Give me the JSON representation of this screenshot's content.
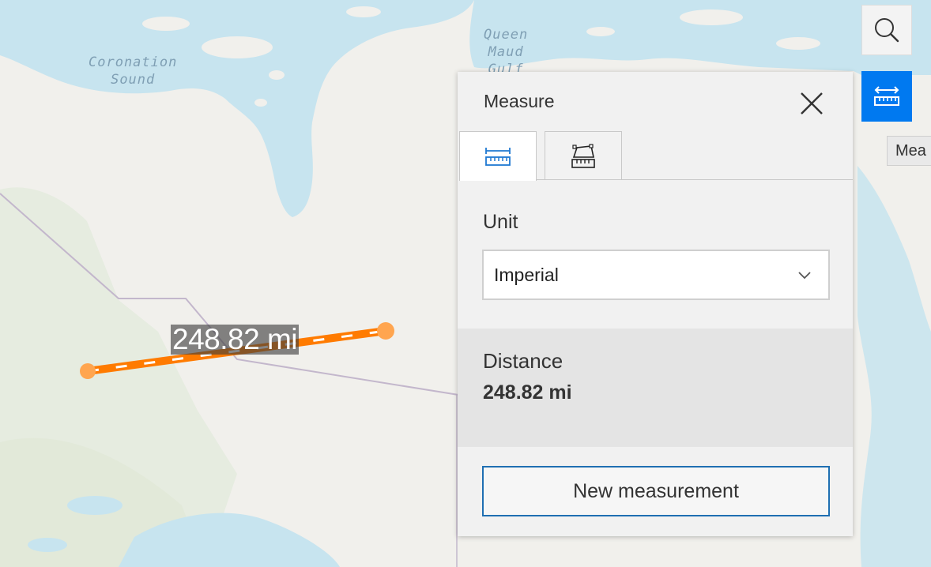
{
  "map": {
    "water_labels": [
      {
        "name": "coronation-sound",
        "text": "Coronation\nSound"
      },
      {
        "name": "queen-maud-gulf",
        "text": "Queen\nMaud\nGulf"
      }
    ],
    "measurement_label": "248.82 mi",
    "colors": {
      "land": "#f1f0ec",
      "water": "#c7e4ef",
      "vegetation": "#e2eadb",
      "measure_line": "#ff7b00",
      "boundary": "#c3b7cc"
    }
  },
  "controls": {
    "search_icon": "search-icon",
    "measure_icon": "measure-ruler-icon",
    "tooltip": "Mea",
    "accent_color": "#0079f0"
  },
  "panel": {
    "title": "Measure",
    "close_icon": "close-icon",
    "tabs": [
      {
        "name": "distance",
        "icon": "ruler-distance-icon",
        "active": true
      },
      {
        "name": "area",
        "icon": "ruler-area-icon",
        "active": false
      }
    ],
    "unit_label": "Unit",
    "unit_value": "Imperial",
    "result_label": "Distance",
    "result_value": "248.82 mi",
    "new_button": "New measurement"
  }
}
